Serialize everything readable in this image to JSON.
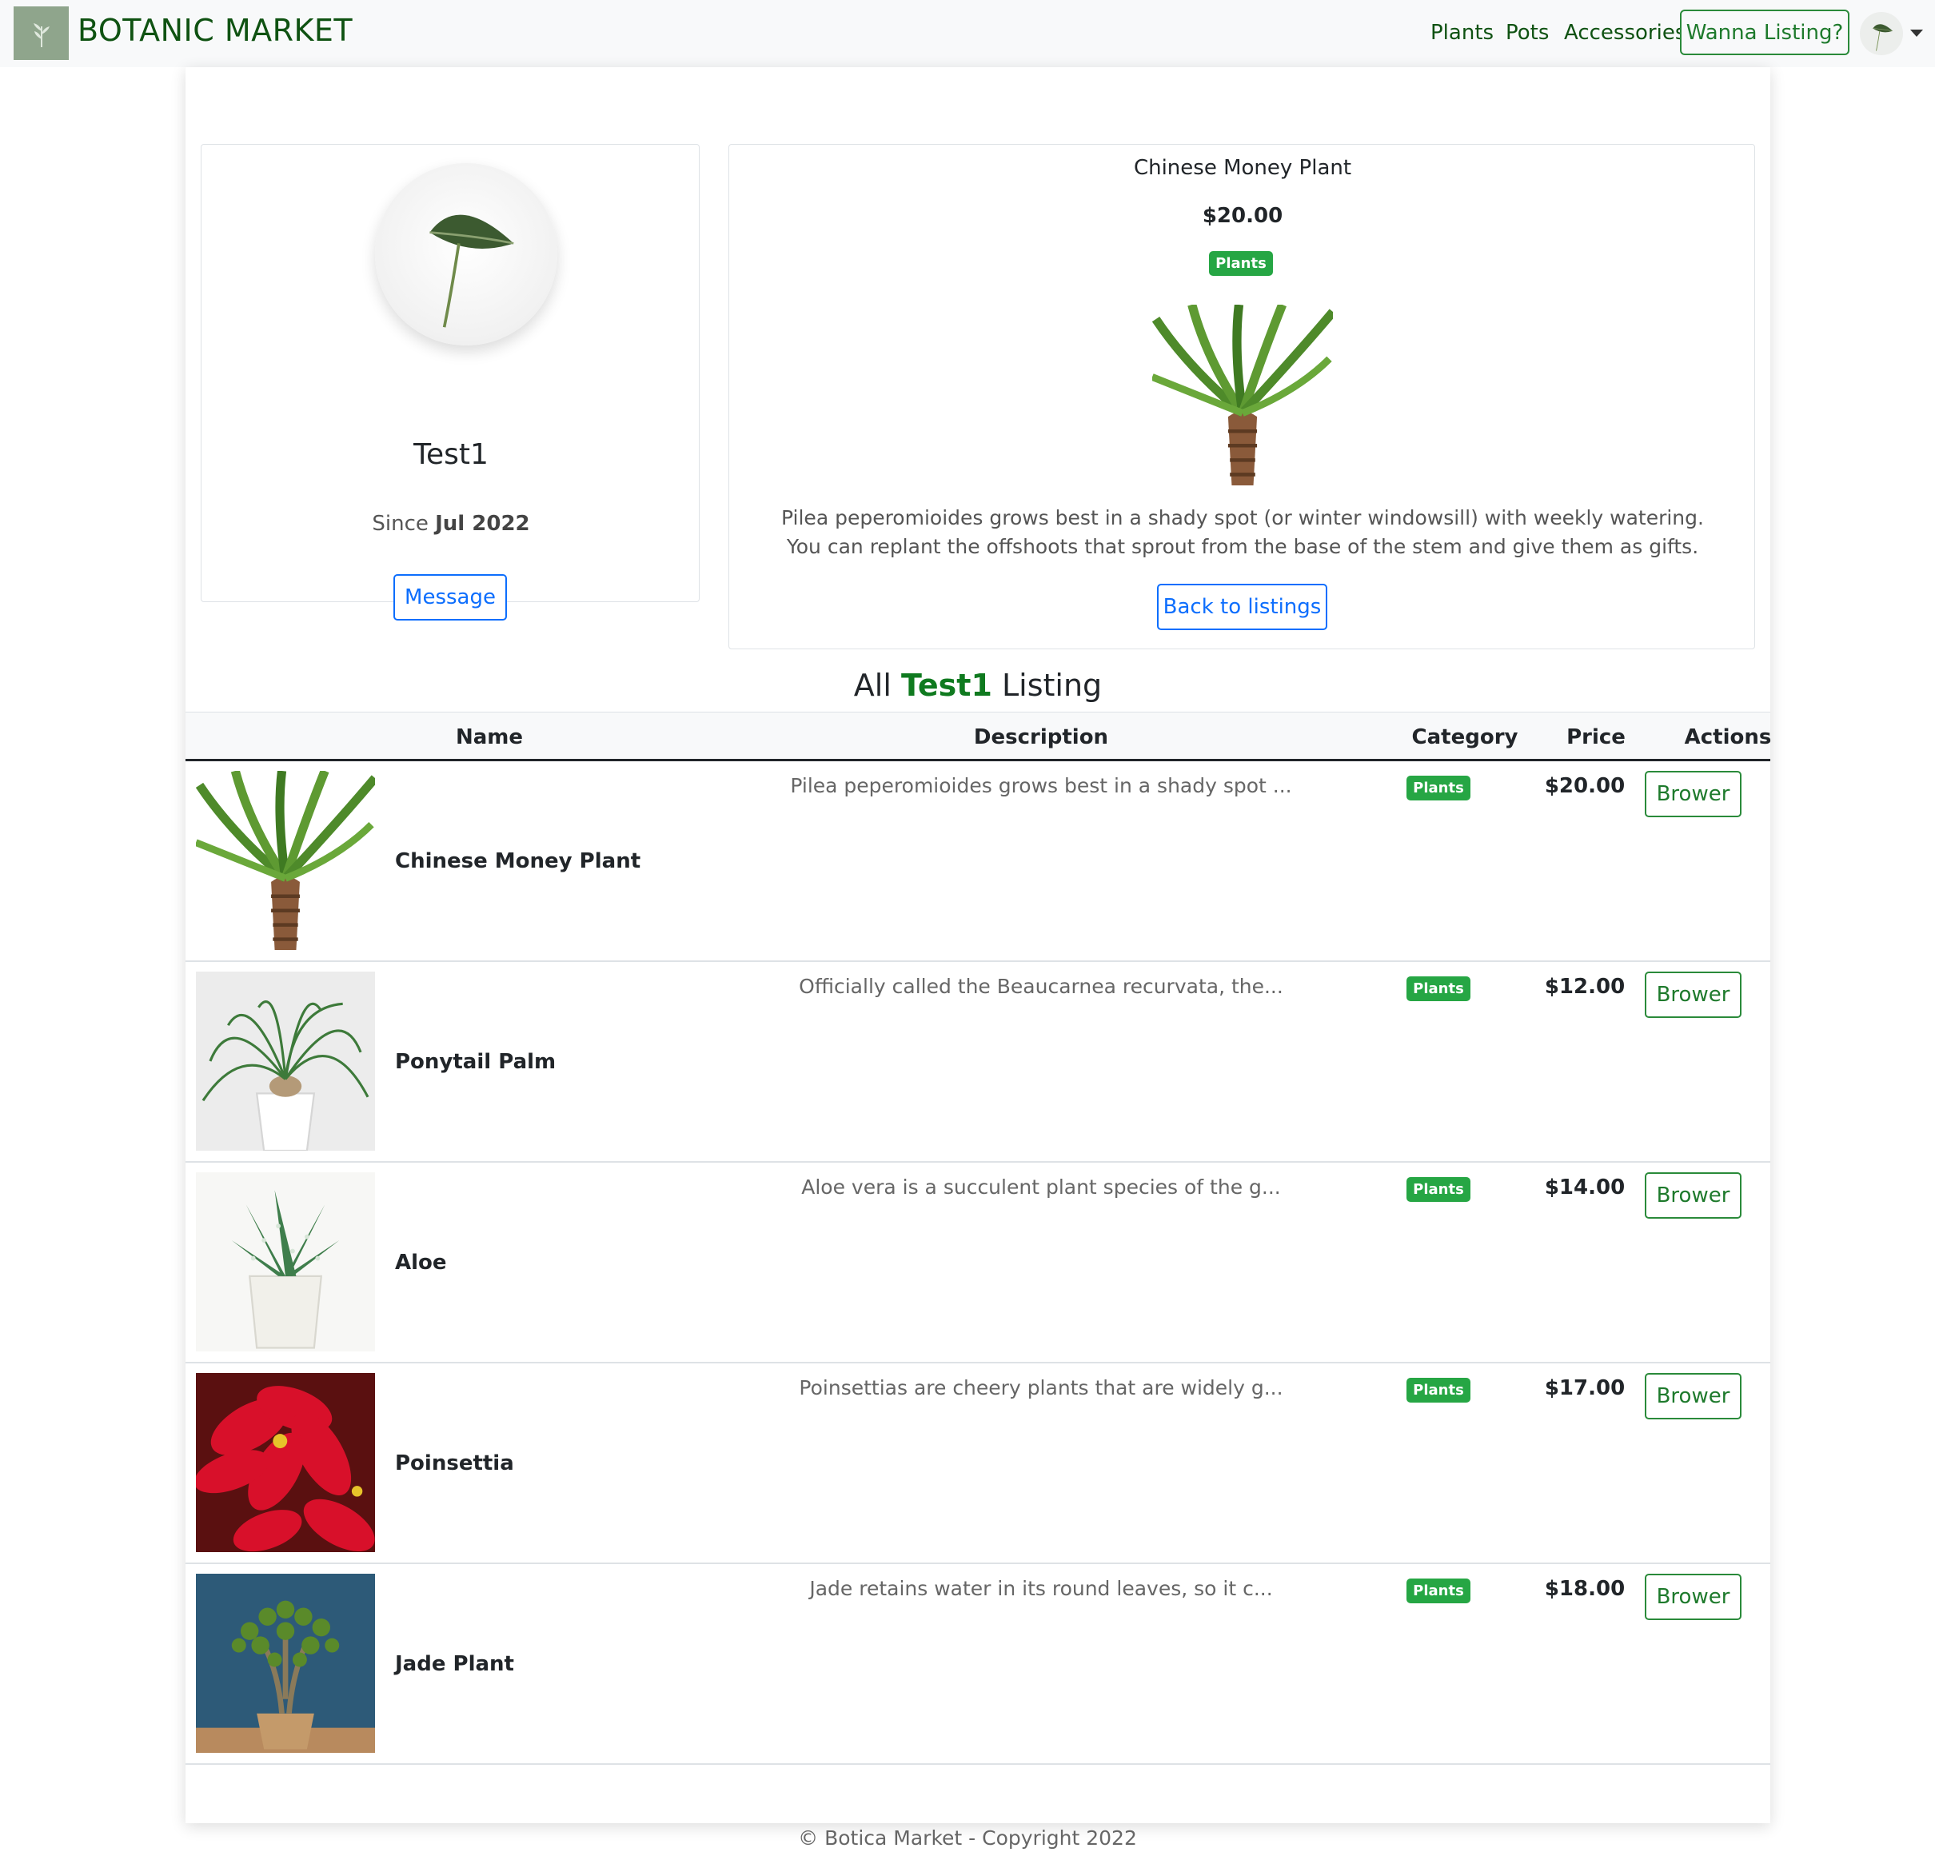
{
  "nav": {
    "brand": "BOTANIC MARKET",
    "links": [
      "Plants",
      "Pots",
      "Accessories"
    ],
    "cta": "Wanna Listing?"
  },
  "profile": {
    "name": "Test1",
    "since_label": "Since",
    "since_value": "Jul 2022",
    "message_button": "Message"
  },
  "detail": {
    "title": "Chinese Money Plant",
    "price": "$20.00",
    "category": "Plants",
    "description": "Pilea peperomioides grows best in a shady spot (or winter windowsill) with weekly watering. You can replant the offshoots that sprout from the base of the stem and give them as gifts.",
    "back_button": "Back to listings"
  },
  "listing": {
    "heading_prefix": "All",
    "heading_user": "Test1",
    "heading_suffix": "Listing",
    "columns": [
      "Name",
      "Description",
      "Category",
      "Price",
      "Actions"
    ],
    "rows": [
      {
        "name": "Chinese Money Plant",
        "description": "Pilea peperomioides grows best in a shady spot ...",
        "category": "Plants",
        "price": "$20.00",
        "action": "Brower",
        "image": "yucca-trunk"
      },
      {
        "name": "Ponytail Palm",
        "description": "Officially called the Beaucarnea recurvata, the...",
        "category": "Plants",
        "price": "$12.00",
        "action": "Brower",
        "image": "ponytail-palm-pot"
      },
      {
        "name": "Aloe",
        "description": "Aloe vera is a succulent plant species of the g...",
        "category": "Plants",
        "price": "$14.00",
        "action": "Brower",
        "image": "aloe-pot"
      },
      {
        "name": "Poinsettia",
        "description": "Poinsettias are cheery plants that are widely g...",
        "category": "Plants",
        "price": "$17.00",
        "action": "Brower",
        "image": "poinsettia"
      },
      {
        "name": "Jade Plant",
        "description": "Jade retains water in its round leaves, so it c...",
        "category": "Plants",
        "price": "$18.00",
        "action": "Brower",
        "image": "jade-plant-pot"
      }
    ]
  },
  "footer": "© Botica Market - Copyright 2022",
  "colors": {
    "brand": "#0f5212",
    "badge": "#26a644",
    "primary": "#0d6efd",
    "success_outline": "#2a8a3a"
  }
}
